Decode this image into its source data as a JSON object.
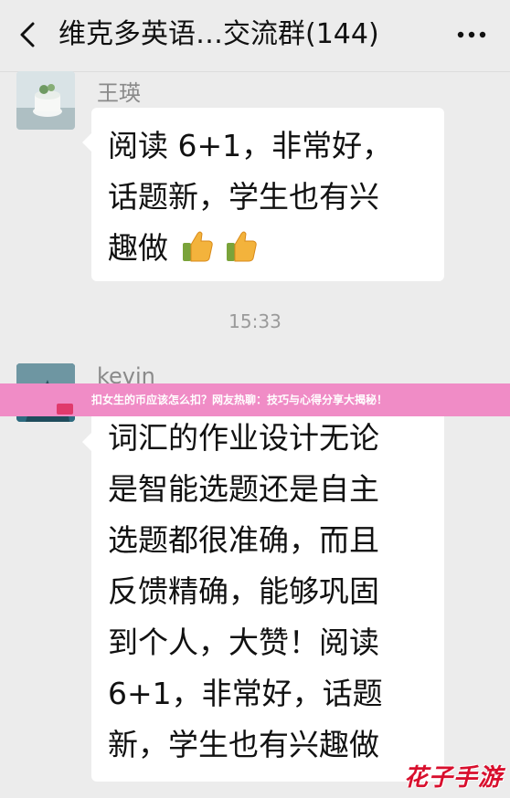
{
  "header": {
    "title": "维克多英语…交流群(144)",
    "back_icon": "chevron-left-icon",
    "more_icon": "ellipsis-icon"
  },
  "messages": [
    {
      "sender": "王瑛",
      "lines": [
        "阅读 6+1，非常好，",
        "话题新，学生也有兴",
        "趣做"
      ],
      "emoji": [
        "thumbs-up-icon",
        "thumbs-up-icon"
      ]
    },
    {
      "sender": "kevin",
      "lines": [
        "词汇的作业设计无论",
        "是智能选题还是自主",
        "选题都很准确，而且",
        "反馈精确，能够巩固",
        "到个人，大赞！阅读",
        "6+1，非常好，话题",
        "新，学生也有兴趣做"
      ]
    }
  ],
  "timestamp": "15:33",
  "banner": {
    "text": "扣女生的币应该怎么扣？网友热聊：技巧与心得分享大揭秘！"
  },
  "watermark": {
    "text": "花子手游"
  },
  "colors": {
    "background": "#ececec",
    "bubble": "#ffffff",
    "banner": "#f08cc6",
    "watermark": "#d80f2d"
  }
}
